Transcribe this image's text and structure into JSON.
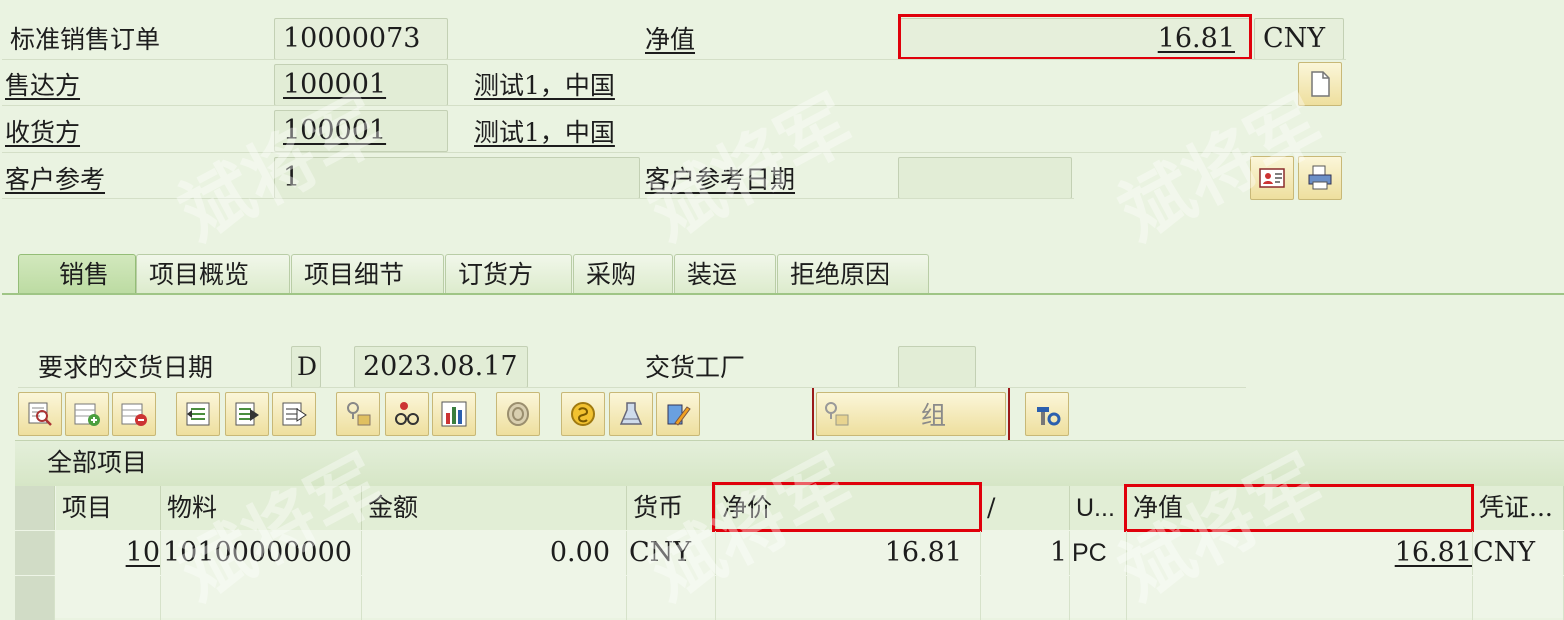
{
  "header": {
    "order_type": "标准销售订单",
    "order_number": "10000073",
    "net_value_label": "净值",
    "net_value": "16.81",
    "currency": "CNY",
    "sold_to_label": "售达方",
    "sold_to": "100001",
    "sold_to_name": "测试1，中国",
    "ship_to_label": "收货方",
    "ship_to": "100001",
    "ship_to_name": "测试1，中国",
    "cust_ref_label": "客户参考",
    "cust_ref": "1",
    "cust_ref_date_label": "客户参考日期",
    "cust_ref_date": ""
  },
  "tabs": [
    "销售",
    "项目概览",
    "项目细节",
    "订货方",
    "采购",
    "装运",
    "拒绝原因"
  ],
  "sales": {
    "req_delivery_label": "要求的交货日期",
    "date_type": "D",
    "req_delivery_date": "2023.08.17",
    "plant_label": "交货工厂",
    "plant": "",
    "group_label": "组"
  },
  "table": {
    "title": "全部项目",
    "columns": [
      "项目",
      "物料",
      "金额",
      "货币",
      "净价",
      "/",
      "U...",
      "净值",
      "凭证..."
    ],
    "rows": [
      {
        "item": "10",
        "material": "10100000000",
        "amount": "0.00",
        "currency": "CNY",
        "net_price": "16.81",
        "per": "1",
        "unit": "PC",
        "net_value": "16.81",
        "doc_currency": "CNY"
      }
    ]
  },
  "watermark": "斌将军",
  "colors": {
    "accent_red": "#e0000b",
    "background": "#eaf3e1",
    "tab_active": "#bcdba2"
  }
}
